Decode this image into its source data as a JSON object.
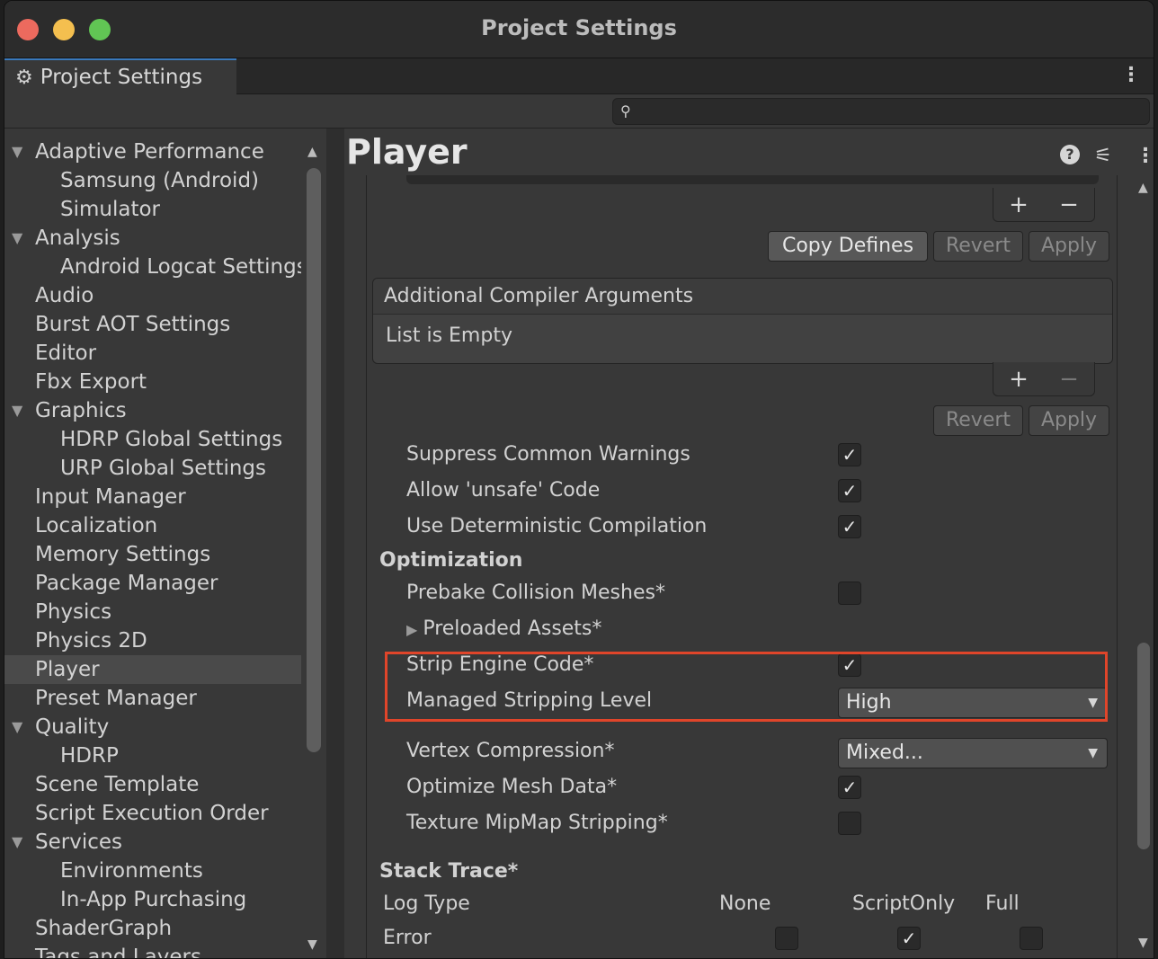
{
  "window": {
    "title": "Project Settings"
  },
  "tab": {
    "label": "Project Settings",
    "icon": "gear-icon"
  },
  "search": {
    "value": "",
    "placeholder": ""
  },
  "sidebar": {
    "items": [
      {
        "label": "Adaptive Performance",
        "level": 0,
        "expanded": true
      },
      {
        "label": "Samsung (Android)",
        "level": 1
      },
      {
        "label": "Simulator",
        "level": 1
      },
      {
        "label": "Analysis",
        "level": 0,
        "expanded": true
      },
      {
        "label": "Android Logcat Settings",
        "level": 1
      },
      {
        "label": "Audio",
        "level": 0
      },
      {
        "label": "Burst AOT Settings",
        "level": 0
      },
      {
        "label": "Editor",
        "level": 0
      },
      {
        "label": "Fbx Export",
        "level": 0
      },
      {
        "label": "Graphics",
        "level": 0,
        "expanded": true
      },
      {
        "label": "HDRP Global Settings",
        "level": 1
      },
      {
        "label": "URP Global Settings",
        "level": 1
      },
      {
        "label": "Input Manager",
        "level": 0
      },
      {
        "label": "Localization",
        "level": 0
      },
      {
        "label": "Memory Settings",
        "level": 0
      },
      {
        "label": "Package Manager",
        "level": 0
      },
      {
        "label": "Physics",
        "level": 0
      },
      {
        "label": "Physics 2D",
        "level": 0
      },
      {
        "label": "Player",
        "level": 0,
        "selected": true
      },
      {
        "label": "Preset Manager",
        "level": 0
      },
      {
        "label": "Quality",
        "level": 0,
        "expanded": true
      },
      {
        "label": "HDRP",
        "level": 1
      },
      {
        "label": "Scene Template",
        "level": 0
      },
      {
        "label": "Script Execution Order",
        "level": 0
      },
      {
        "label": "Services",
        "level": 0,
        "expanded": true
      },
      {
        "label": "Environments",
        "level": 1
      },
      {
        "label": "In-App Purchasing",
        "level": 1
      },
      {
        "label": "ShaderGraph",
        "level": 0
      },
      {
        "label": "Tags and Layers",
        "level": 0
      }
    ]
  },
  "panel": {
    "title": "Player",
    "defines": {
      "plus": "+",
      "minus": "−",
      "copy_defines": "Copy Defines",
      "revert": "Revert",
      "apply": "Apply"
    },
    "compiler_args": {
      "header": "Additional Compiler Arguments",
      "empty": "List is Empty",
      "plus": "+",
      "minus": "−",
      "revert": "Revert",
      "apply": "Apply"
    },
    "toggles": {
      "suppress_warnings": {
        "label": "Suppress Common Warnings",
        "checked": true
      },
      "allow_unsafe": {
        "label": "Allow 'unsafe' Code",
        "checked": true
      },
      "deterministic": {
        "label": "Use Deterministic Compilation",
        "checked": true
      }
    },
    "optimization": {
      "header": "Optimization",
      "prebake": {
        "label": "Prebake Collision Meshes*",
        "checked": false
      },
      "preloaded": {
        "label": "Preloaded Assets*"
      },
      "strip_engine": {
        "label": "Strip Engine Code*",
        "checked": true
      },
      "stripping_level": {
        "label": "Managed Stripping Level",
        "value": "High"
      },
      "vertex_compression": {
        "label": "Vertex Compression*",
        "value": "Mixed..."
      },
      "optimize_mesh": {
        "label": "Optimize Mesh Data*",
        "checked": true
      },
      "mipmap_stripping": {
        "label": "Texture MipMap Stripping*",
        "checked": false
      }
    },
    "stack_trace": {
      "header": "Stack Trace*",
      "col_log_type": "Log Type",
      "col_none": "None",
      "col_script_only": "ScriptOnly",
      "col_full": "Full",
      "row_error": {
        "label": "Error",
        "none": false,
        "script_only": true,
        "full": false
      }
    }
  },
  "colors": {
    "highlight": "#e0452a",
    "background": "#383838",
    "accent_tab": "#3a79bb"
  }
}
